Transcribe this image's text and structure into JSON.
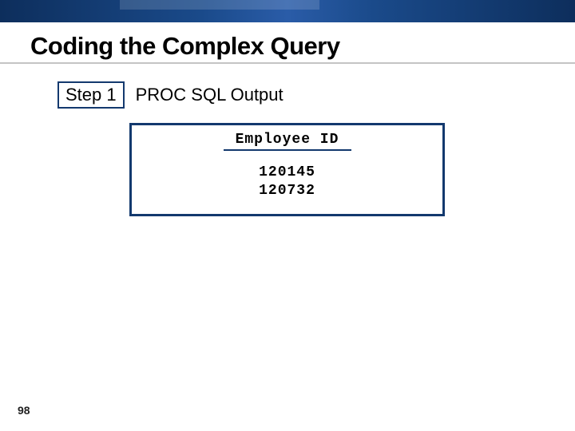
{
  "slide": {
    "title": "Coding the Complex Query",
    "page_number": "98"
  },
  "step": {
    "label": "Step 1",
    "subtitle": "PROC SQL Output"
  },
  "output": {
    "header": "Employee ID",
    "values": [
      "120145",
      "120732"
    ]
  }
}
